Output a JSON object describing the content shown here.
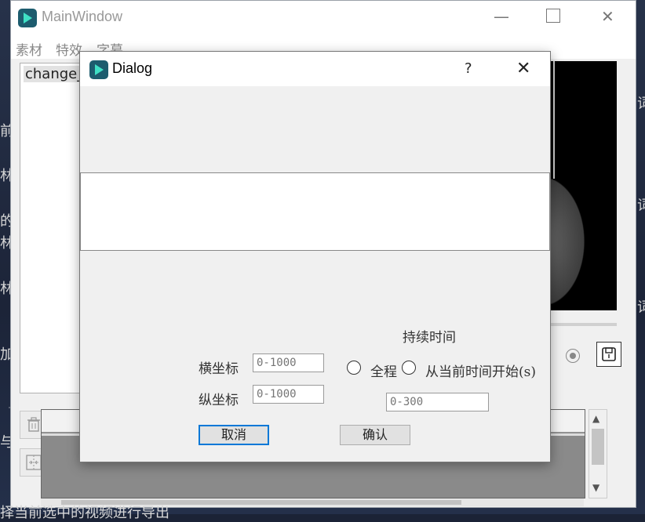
{
  "main_window": {
    "title": "MainWindow",
    "menu": [
      "素材",
      "特效",
      "字幕"
    ],
    "list_items": [
      "change_"
    ],
    "side_left_text": [
      "前",
      "林",
      "的",
      "林",
      "林",
      "加",
      "与"
    ],
    "side_right_text": [
      "词",
      "词",
      "词"
    ],
    "status_text": "择当前选中的视频进行导出"
  },
  "dialog": {
    "title": "Dialog",
    "help_label": "?",
    "close_label": "✕",
    "duration_label": "持续时间",
    "x_label": "横坐标",
    "y_label": "纵坐标",
    "x_placeholder": "0-1000",
    "y_placeholder": "0-1000",
    "radio_full": "全程",
    "radio_from_current": "从当前时间开始(s)",
    "time_placeholder": "0-300",
    "cancel_label": "取消",
    "confirm_label": "确认"
  }
}
